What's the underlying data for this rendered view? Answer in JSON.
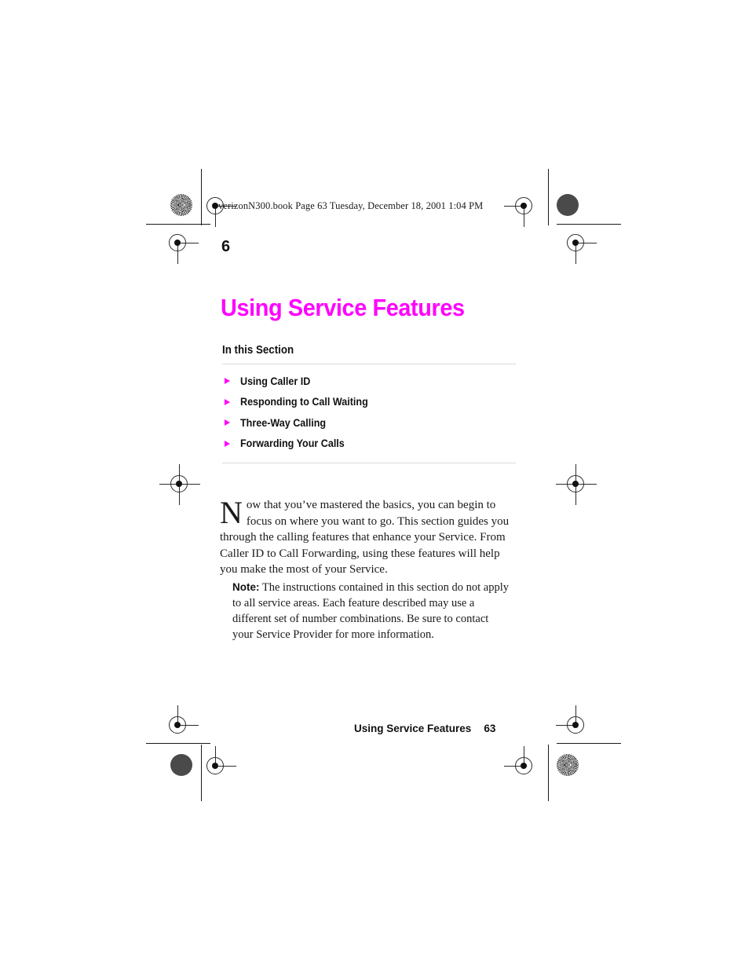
{
  "document": {
    "header_line": "verizonN300.book  Page 63  Tuesday, December 18, 2001  1:04 PM",
    "chapter_number": "6",
    "chapter_title": "Using Service Features",
    "section_heading": "In this Section",
    "toc_items": [
      {
        "label": "Using Caller ID"
      },
      {
        "label": "Responding to Call Waiting"
      },
      {
        "label": "Three-Way Calling"
      },
      {
        "label": "Forwarding Your Calls"
      }
    ],
    "intro": {
      "dropcap": "N",
      "body": "ow that you’ve mastered the basics, you can begin to focus on where you want to go. This section guides you through the calling features that enhance your Service. From Caller ID to Call Forwarding, using these features will help you make the most of your Service."
    },
    "note": {
      "label": "Note:",
      "body": "The instructions contained in this section do not apply to all service areas. Each feature described may use a different set of number combinations. Be sure to contact your Service Provider for more information."
    },
    "footer": {
      "title": "Using Service Features",
      "page_number": "63"
    }
  },
  "colors": {
    "accent_magenta": "#FF00FF",
    "text_black": "#1a1a1a",
    "rule_gray": "#d9d9d9"
  }
}
